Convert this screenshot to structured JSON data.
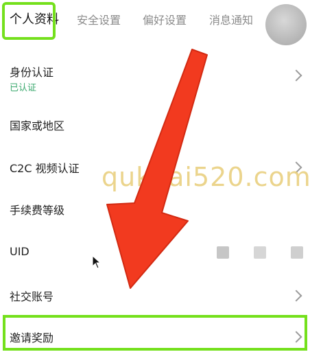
{
  "tabs": [
    {
      "label": "个人资料",
      "active": true
    },
    {
      "label": "安全设置",
      "active": false
    },
    {
      "label": "偏好设置",
      "active": false
    },
    {
      "label": "消息通知",
      "active": false
    }
  ],
  "profile_rows": {
    "identity": {
      "label": "身份认证",
      "status": "已认证"
    },
    "country": {
      "label": "国家或地区"
    },
    "c2c_video": {
      "label": "C2C 视频认证"
    },
    "fee_level": {
      "label": "手续费等级"
    },
    "uid": {
      "label": "UID"
    },
    "social": {
      "label": "社交账号"
    },
    "invite": {
      "label": "邀请奖励"
    }
  },
  "watermark": "qukuai520.com",
  "colors": {
    "highlight_green": "#74e01c",
    "arrow_red": "#f23a1f",
    "verified_green": "#3aa86d",
    "watermark_gold": "#e8cd78"
  }
}
